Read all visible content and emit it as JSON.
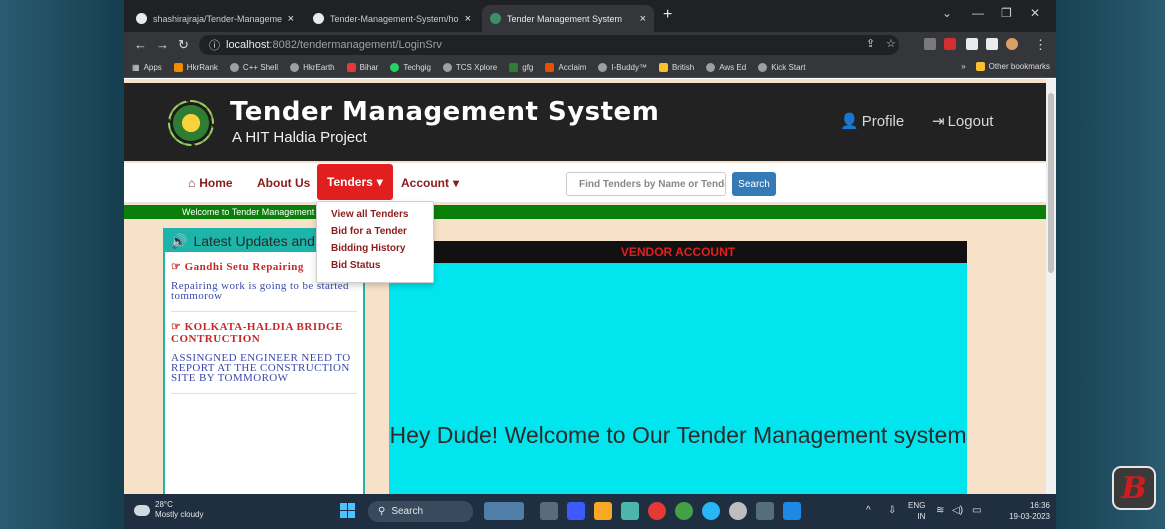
{
  "browser": {
    "tabs": [
      {
        "label": "shashirajraja/Tender-Manageme",
        "active": false
      },
      {
        "label": "Tender-Management-System/ho",
        "active": false
      },
      {
        "label": "Tender Management System",
        "active": true
      }
    ],
    "url_host": "localhost",
    "url_rest": ":8082/tendermanagement/LoginSrv",
    "bookmarks": [
      "Apps",
      "HkrRank",
      "C++ Shell",
      "HkrEarth",
      "Bihar",
      "Techgig",
      "TCS Xplore",
      "gfg",
      "Acclaim",
      "I-Buddy™",
      "British",
      "Aws Ed",
      "Kick Start"
    ],
    "other_bookmarks": "Other bookmarks",
    "bookmark_colors": [
      "#4285f4",
      "#f28b00",
      "#9aa0a6",
      "#9aa0a6",
      "#e53935",
      "#25d366",
      "#9aa0a6",
      "#2e7d32",
      "#e65100",
      "#9aa0a6",
      "#fbc02d",
      "#9aa0a6",
      "#9aa0a6"
    ]
  },
  "site": {
    "title": "Tender Management System",
    "subtitle": "A HIT Haldia Project",
    "profile_label": "Profile",
    "logout_label": "Logout"
  },
  "nav": {
    "home": "Home",
    "about": "About Us",
    "tenders": "Tenders",
    "account": "Account",
    "search_placeholder": "Find Tenders by Name or Tender ID",
    "search_button": "Search"
  },
  "dropdown": [
    "View all Tenders",
    "Bid for a Tender",
    "Bidding History",
    "Bid Status"
  ],
  "ticker": "Welcome to Tender Management System",
  "updates": {
    "heading": "Latest Updates and News",
    "items": [
      {
        "title": "Gandhi Setu Repairing",
        "body": "Repairing work is going to be started tommorow"
      },
      {
        "title": "KOLKATA-HALDIA BRIDGE CONTRUCTION",
        "body": "ASSINGNED ENGINEER NEED TO REPORT AT THE CONSTRUCTION SITE BY TOMMOROW"
      }
    ]
  },
  "main": {
    "vendor_heading": "VENDOR ACCOUNT",
    "welcome": "Hey Dude! Welcome to Our Tender Management system"
  },
  "taskbar": {
    "temperature": "28°C",
    "weather": "Mostly cloudy",
    "search": "Search",
    "lang_top": "ENG",
    "lang_bottom": "IN",
    "time": "16:36",
    "date": "19-03-2023"
  },
  "colors": {
    "accent_red": "#e21f1f",
    "ticker_green": "#0a7f0a",
    "panel_cyan": "#00e5ee",
    "page_bg": "#f7e1c8",
    "teal_border": "#1db5a9"
  }
}
